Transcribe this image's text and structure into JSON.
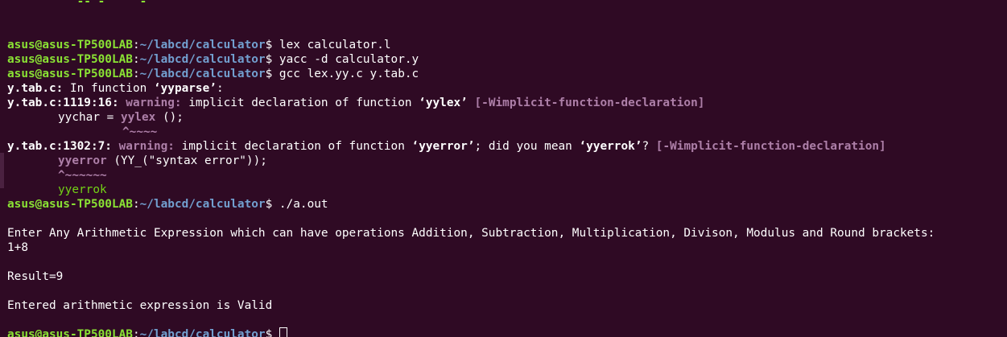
{
  "prompt": {
    "user": "asus@asus-TP500LAB",
    "sep": ":",
    "path": "~/labcd/calculator",
    "symbol": "$"
  },
  "top_partial": "          -- -     -",
  "commands": {
    "c1": " lex calculator.l",
    "c2": " yacc -d calculator.y",
    "c3": " gcc lex.yy.c y.tab.c",
    "c4": " ./a.out"
  },
  "compiler": {
    "l1_file": "y.tab.c:",
    "l1_text": " In function ",
    "l1_func": "‘yyparse’",
    "l1_end": ":",
    "w1_loc": "y.tab.c:1119:16:",
    "w1_label": " warning:",
    "w1_text1": " implicit declaration of function ",
    "w1_func": "‘yylex’",
    "w1_flag": " [-Wimplicit-function-declaration]",
    "w1_src_pre": "yychar = ",
    "w1_src_hl": "yylex",
    "w1_src_post": " ();",
    "w1_caret": "^~~~~",
    "w2_loc": "y.tab.c:1302:7:",
    "w2_label": " warning:",
    "w2_text1": " implicit declaration of function ",
    "w2_func": "‘yyerror’",
    "w2_text2": "; did you mean ",
    "w2_sugg": "‘yyerrok’",
    "w2_text3": "? ",
    "w2_flag": "[-Wimplicit-function-declaration]",
    "w2_src_hl": "yyerror",
    "w2_src_post": " (YY_(\"syntax error\"));",
    "w2_caret": "^~~~~~~",
    "w2_fix": "yyerrok"
  },
  "program": {
    "prompt_text": "Enter Any Arithmetic Expression which can have operations Addition, Subtraction, Multiplication, Divison, Modulus and Round brackets:",
    "input": "1+8",
    "result": "Result=9",
    "valid": "Entered arithmetic expression is Valid"
  },
  "colors": {
    "background": "#2f0a24",
    "user": "#8ae234",
    "path": "#729fcf",
    "warning": "#ad7fa8",
    "fixit": "#73d216"
  }
}
